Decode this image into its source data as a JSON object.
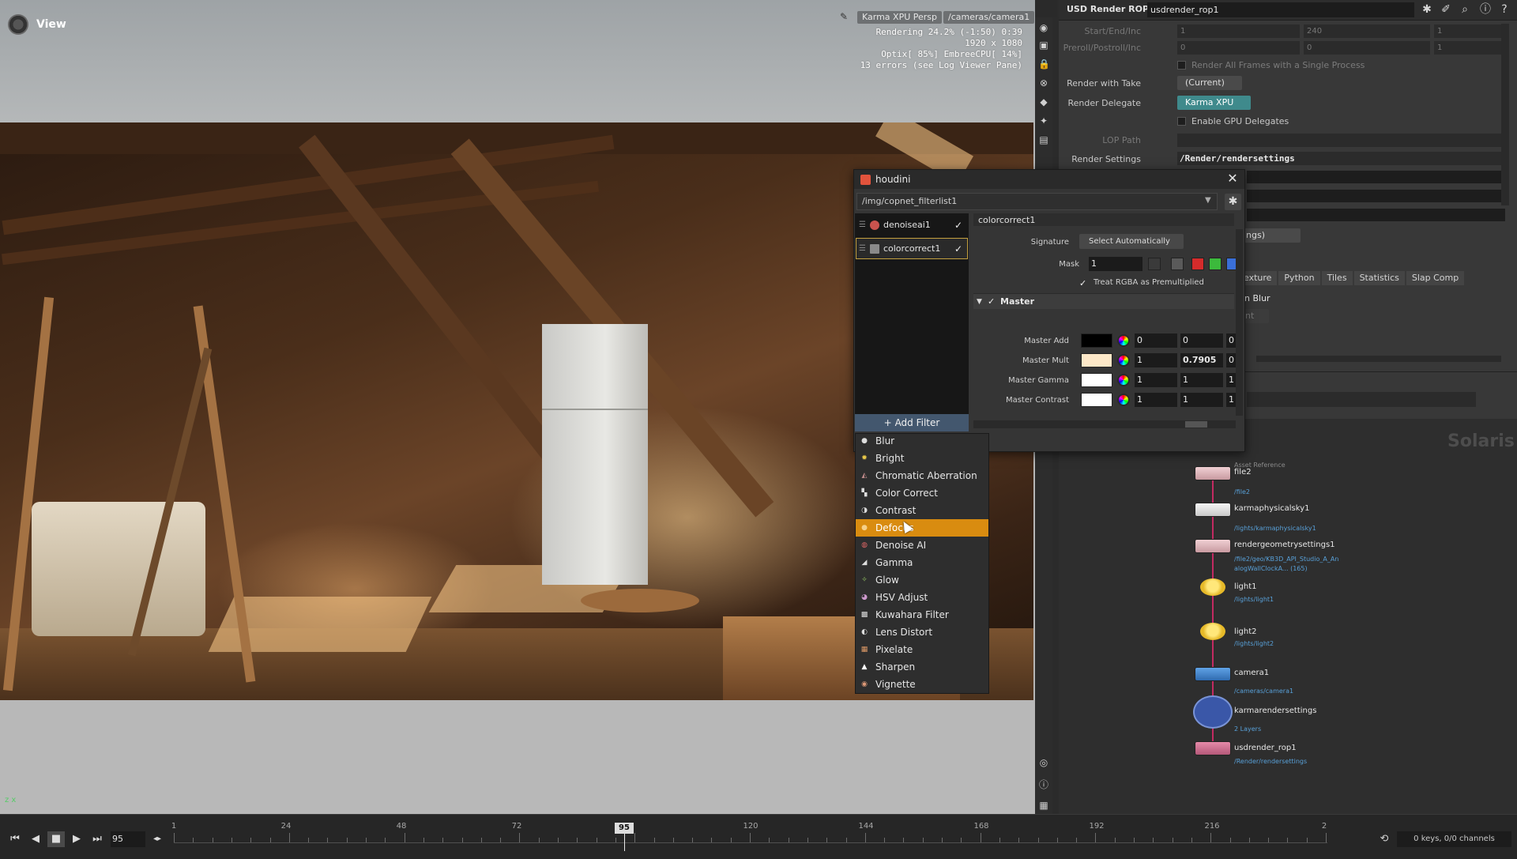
{
  "viewport": {
    "title": "View",
    "renderer_chip": "Karma XPU  Persp",
    "camera_chip": "/cameras/camera1",
    "status_lines": [
      "Rendering  24.2%  (-1:50)  0:39",
      "1920 x 1080",
      "Optix[ 85%] EmbreeCPU[ 14%]",
      "13 errors (see Log Viewer Pane)"
    ],
    "axis_label": "z x"
  },
  "timeline": {
    "current_frame_field": "95",
    "current_frame_marker": "95",
    "ticks": [
      "1",
      "24",
      "48",
      "72",
      "120",
      "144",
      "168",
      "192",
      "216",
      "2"
    ],
    "keys_info": "0 keys, 0/0 channels"
  },
  "rop": {
    "type_label": "USD Render ROP",
    "node_name": "usdrender_rop1",
    "params": {
      "start_end_inc": "Start/End/Inc",
      "start_values": [
        "1",
        "240",
        "1"
      ],
      "preroll": "Preroll/Postroll/Inc",
      "preroll_values": [
        "0",
        "0",
        "1"
      ],
      "render_all_frames": "Render All Frames with a Single Process",
      "render_with_take_label": "Render with Take",
      "render_with_take_value": "(Current)",
      "render_delegate_label": "Render Delegate",
      "render_delegate_value": "Karma XPU",
      "enable_gpu": "Enable GPU Delegates",
      "lop_path_label": "LOP Path",
      "render_settings_label": "Render Settings",
      "render_settings_value": "/Render/rendersettings",
      "partial_menu": "ings)"
    },
    "tabs": [
      "exture",
      "Python",
      "Tiles",
      "Statistics",
      "Slap Comp"
    ],
    "partial_blur": "n Blur",
    "partial_nt": "nt"
  },
  "network": {
    "context": "Solaris",
    "nodes": [
      {
        "name": "file2",
        "path": "/file2",
        "above": "Asset Reference"
      },
      {
        "name": "karmaphysicalsky1",
        "path": "/lights/karmaphysicalsky1"
      },
      {
        "name": "rendergeometrysettings1",
        "path": "/file2/geo/KB3D_API_Studio_A_An",
        "path2": "alogWallClockA... (165)"
      },
      {
        "name": "light1",
        "path": "/lights/light1"
      },
      {
        "name": "light2",
        "path": "/lights/light2"
      },
      {
        "name": "camera1",
        "path": "/cameras/camera1"
      },
      {
        "name": "karmarendersettings",
        "path": "2 Layers"
      },
      {
        "name": "usdrender_rop1",
        "path": "/Render/rendersettings"
      }
    ]
  },
  "dialog": {
    "title": "houdini",
    "path": "/img/copnet_filterlist1",
    "filters": [
      "denoiseai1",
      "colorcorrect1"
    ],
    "add_filter": "Add Filter",
    "node_name": "colorcorrect1",
    "signature_label": "Signature",
    "signature_value": "Select Automatically",
    "mask_label": "Mask",
    "mask_value": "1",
    "premult_label": "Treat RGBA as Premultiplied",
    "master_label": "Master",
    "rows": [
      {
        "label": "Master Add",
        "color": "#000000",
        "v1": "0",
        "v2": "0",
        "v3": "0"
      },
      {
        "label": "Master Mult",
        "color": "#fde8c8",
        "v1": "1",
        "v2": "0.7905",
        "v3": "0"
      },
      {
        "label": "Master Gamma",
        "color": "#ffffff",
        "v1": "1",
        "v2": "1",
        "v3": "1"
      },
      {
        "label": "Master Contrast",
        "color": "#ffffff",
        "v1": "1",
        "v2": "1",
        "v3": "1"
      }
    ]
  },
  "menu": {
    "items": [
      {
        "label": "Blur",
        "icon": "dot-icon"
      },
      {
        "label": "Bright",
        "icon": "sun-icon"
      },
      {
        "label": "Chromatic Aberration",
        "icon": "prism-icon"
      },
      {
        "label": "Color Correct",
        "icon": "palette-icon"
      },
      {
        "label": "Contrast",
        "icon": "half-circle-icon"
      },
      {
        "label": "Defocus",
        "icon": "lens-icon"
      },
      {
        "label": "Denoise AI",
        "icon": "brain-icon"
      },
      {
        "label": "Gamma",
        "icon": "gamma-icon"
      },
      {
        "label": "Glow",
        "icon": "glow-icon"
      },
      {
        "label": "HSV Adjust",
        "icon": "hsv-icon"
      },
      {
        "label": "Kuwahara Filter",
        "icon": "kuwahara-icon"
      },
      {
        "label": "Lens Distort",
        "icon": "distort-icon"
      },
      {
        "label": "Pixelate",
        "icon": "pixel-icon"
      },
      {
        "label": "Sharpen",
        "icon": "triangle-icon"
      },
      {
        "label": "Vignette",
        "icon": "vignette-icon"
      }
    ],
    "highlighted": "Defocus"
  },
  "colors": {
    "accent_orange": "#d98c10",
    "teal": "#3f8a8c",
    "wire": "#c32a62",
    "node_path_blue": "#58a0d8"
  }
}
